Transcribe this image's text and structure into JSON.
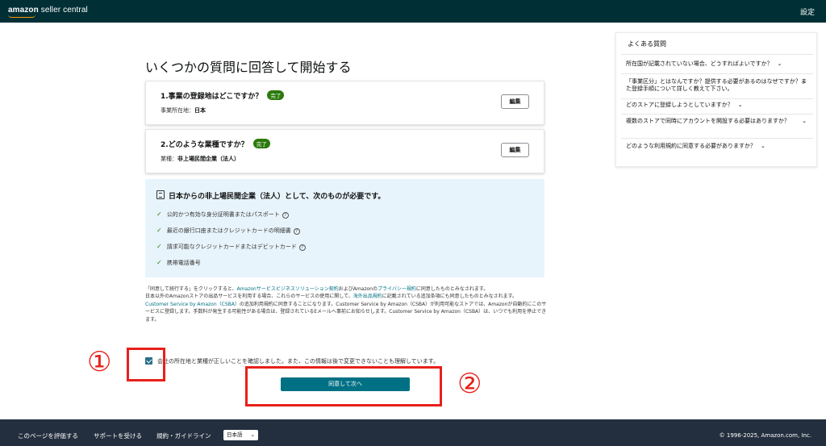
{
  "header": {
    "logo_text_bold": "amazon",
    "logo_text_rest": " seller central",
    "settings_label": "設定"
  },
  "main": {
    "title": "いくつかの質問に回答して開始する",
    "cards": [
      {
        "question": "1.事業の登録地はどこですか？",
        "badge": "完了",
        "info_label": "事業所在地：",
        "info_value": "日本",
        "edit_label": "編集"
      },
      {
        "question": "2.どのような業種ですか？",
        "badge": "完了",
        "info_label": "業種：",
        "info_value": "非上場民間企業（法人）",
        "edit_label": "編集"
      }
    ],
    "requirements": {
      "heading": "日本からの非上場民間企業（法人）として、次のものが必要です。",
      "items": [
        "公的かつ有効な身分証明書またはパスポート",
        "最近の銀行口座またはクレジットカードの明細書",
        "請求可能なクレジットカードまたはデビットカード",
        "携帯電話番号"
      ]
    },
    "legal": {
      "p1_a": "「同意して続行する」をクリックすると、",
      "p1_link1": "Amazonサービスビジネスソリューション契約",
      "p1_b": "およびAmazonの",
      "p1_link2": "プライバシー規約",
      "p1_c": "に同意したものとみなされます。",
      "p2_a": "日本以外のAmazonストアの出品サービスを利用する場合、これらのサービスの使用に関して、",
      "p2_link": "海外出品規約",
      "p2_b": "に記載されている追加条項にも同意したものとみなされます。",
      "p3_link": "Customer Service by Amazon（CSBA）",
      "p3_a": "の追加利用規約に同意することになります。Customer Service by Amazon（CSBA）が利用可能なストアでは、Amazonが自動的にこのサービスに登録します。手数料が発生する可能性がある場合は、登録されているEメールへ事前にお知らせします。Customer Service by Amazon（CSBA）は、いつでも利用を停止できます。"
    },
    "agree_text": "会社の所在地と業種が正しいことを確認しました。また、この情報は後で変更できないことも理解しています。",
    "agree_button": "同意して次へ"
  },
  "annotations": {
    "num1": "①",
    "num2": "②"
  },
  "faq": {
    "title": "よくある質問",
    "items": [
      "所在国が記載されていない場合、どうすればよいですか？",
      "「事業区分」とはなんですか？提供する必要があるのはなぜですか？また登録手順について詳しく教えて下さい。",
      "どのストアに登録しようとしていますか？",
      "複数のストアで同時にアカウントを開設する必要はありますか？",
      "どのような利用規約に同意する必要がありますか？"
    ]
  },
  "footer": {
    "links": [
      "このページを評価する",
      "サポートを受ける",
      "規約・ガイドライン"
    ],
    "language": "日本語",
    "copyright": "© 1996-2025, Amazon.com, Inc."
  },
  "colors": {
    "header_bg": "#002f36",
    "footer_bg": "#232f3e",
    "accent": "#007185",
    "badge": "#2b7a0b",
    "annotation_red": "#e8201a"
  }
}
